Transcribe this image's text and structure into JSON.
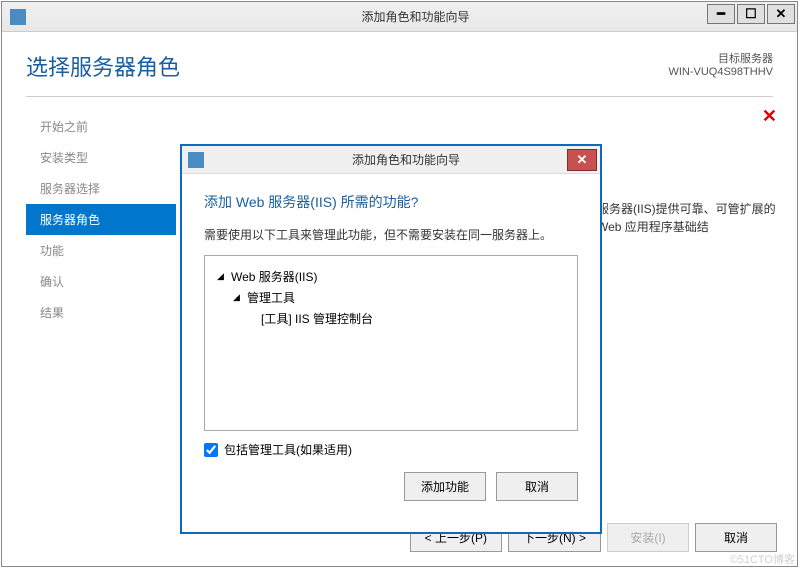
{
  "window": {
    "title": "添加角色和功能向导",
    "minimize": "━",
    "maximize": "☐",
    "close": "✕"
  },
  "header": {
    "title": "选择服务器角色",
    "target_label": "目标服务器",
    "target_value": "WIN-VUQ4S98THHV",
    "red_close": "✕"
  },
  "nav": {
    "items": [
      {
        "label": "开始之前"
      },
      {
        "label": "安装类型"
      },
      {
        "label": "服务器选择"
      },
      {
        "label": "服务器角色"
      },
      {
        "label": "功能"
      },
      {
        "label": "确认"
      },
      {
        "label": "结果"
      }
    ],
    "active_index": 3
  },
  "desc_right": "服务器(IIS)提供可靠、可管扩展的 Web 应用程序基础结",
  "footer": {
    "prev": "< 上一步(P)",
    "next": "下一步(N) >",
    "install": "安装(I)",
    "cancel": "取消"
  },
  "modal": {
    "title": "添加角色和功能向导",
    "close": "✕",
    "heading": "添加 Web 服务器(IIS) 所需的功能?",
    "desc": "需要使用以下工具来管理此功能，但不需要安装在同一服务器上。",
    "tree": {
      "n0": "Web 服务器(IIS)",
      "n1": "管理工具",
      "n2": "[工具] IIS 管理控制台"
    },
    "checkbox_label": "包括管理工具(如果适用)",
    "checkbox_checked": true,
    "add_btn": "添加功能",
    "cancel_btn": "取消"
  },
  "watermark": "©51CTO博客"
}
